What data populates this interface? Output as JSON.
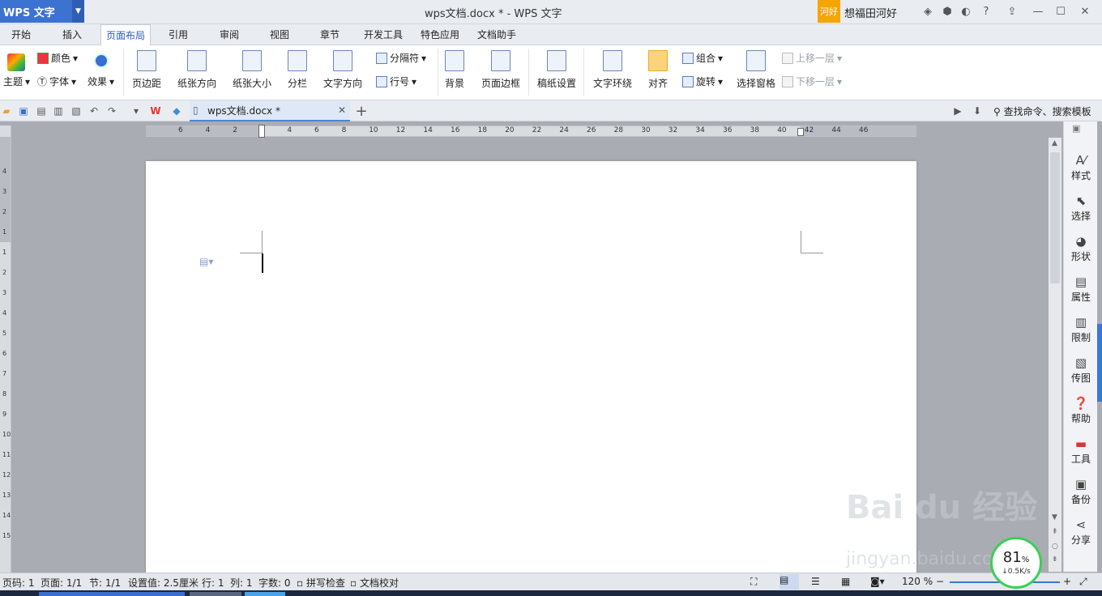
{
  "app": {
    "logo": "WPS 文字",
    "title": "wps文档.docx * - WPS 文字",
    "ad": "河好",
    "user": "想福田河好"
  },
  "tabs": [
    "开始",
    "插入",
    "页面布局",
    "引用",
    "审阅",
    "视图",
    "章节",
    "开发工具",
    "特色应用",
    "文档助手"
  ],
  "ribbon": {
    "theme": "主题",
    "color": "颜色",
    "font": "字体",
    "effect": "效果",
    "margin": "页边距",
    "orientation": "纸张方向",
    "size": "纸张大小",
    "columns": "分栏",
    "textdir": "文字方向",
    "breaks": "分隔符",
    "linenum": "行号",
    "background": "背景",
    "border": "页面边框",
    "draft": "稿纸设置",
    "wrap": "文字环绕",
    "align": "对齐",
    "group": "组合",
    "rotate": "旋转",
    "selpane": "选择窗格",
    "forward": "上移一层",
    "backward": "下移一层"
  },
  "toolbar": {
    "doc_tab": "wps文档.docx *",
    "search": "查找命令、搜索模板"
  },
  "ruler_h": [
    "6",
    "4",
    "2",
    "2",
    "4",
    "6",
    "8",
    "10",
    "12",
    "14",
    "16",
    "18",
    "20",
    "22",
    "24",
    "26",
    "28",
    "30",
    "32",
    "34",
    "36",
    "38",
    "40",
    "42",
    "44",
    "46"
  ],
  "ruler_v": [
    "4",
    "3",
    "2",
    "1",
    "1",
    "2",
    "3",
    "4",
    "5",
    "6",
    "7",
    "8",
    "9",
    "10",
    "11",
    "12",
    "13",
    "14",
    "15"
  ],
  "right_panel": [
    "样式",
    "选择",
    "形状",
    "属性",
    "限制",
    "传图",
    "帮助",
    "工具",
    "备份",
    "分享"
  ],
  "status": {
    "page": "页码: 1",
    "pages": "页面: 1/1",
    "section": "节: 1/1",
    "setting": "设置值: 2.5厘米",
    "row": "行: 1",
    "col": "列: 1",
    "words": "字数: 0",
    "spell": "拼写检查",
    "proof": "文档校对",
    "zoom": "120 %"
  },
  "speed": {
    "percent": "81",
    "unit": "%",
    "rate": "0.5K/s"
  },
  "watermark": {
    "main": "Bai du 经验",
    "sub": "jingyan.baidu.com"
  }
}
